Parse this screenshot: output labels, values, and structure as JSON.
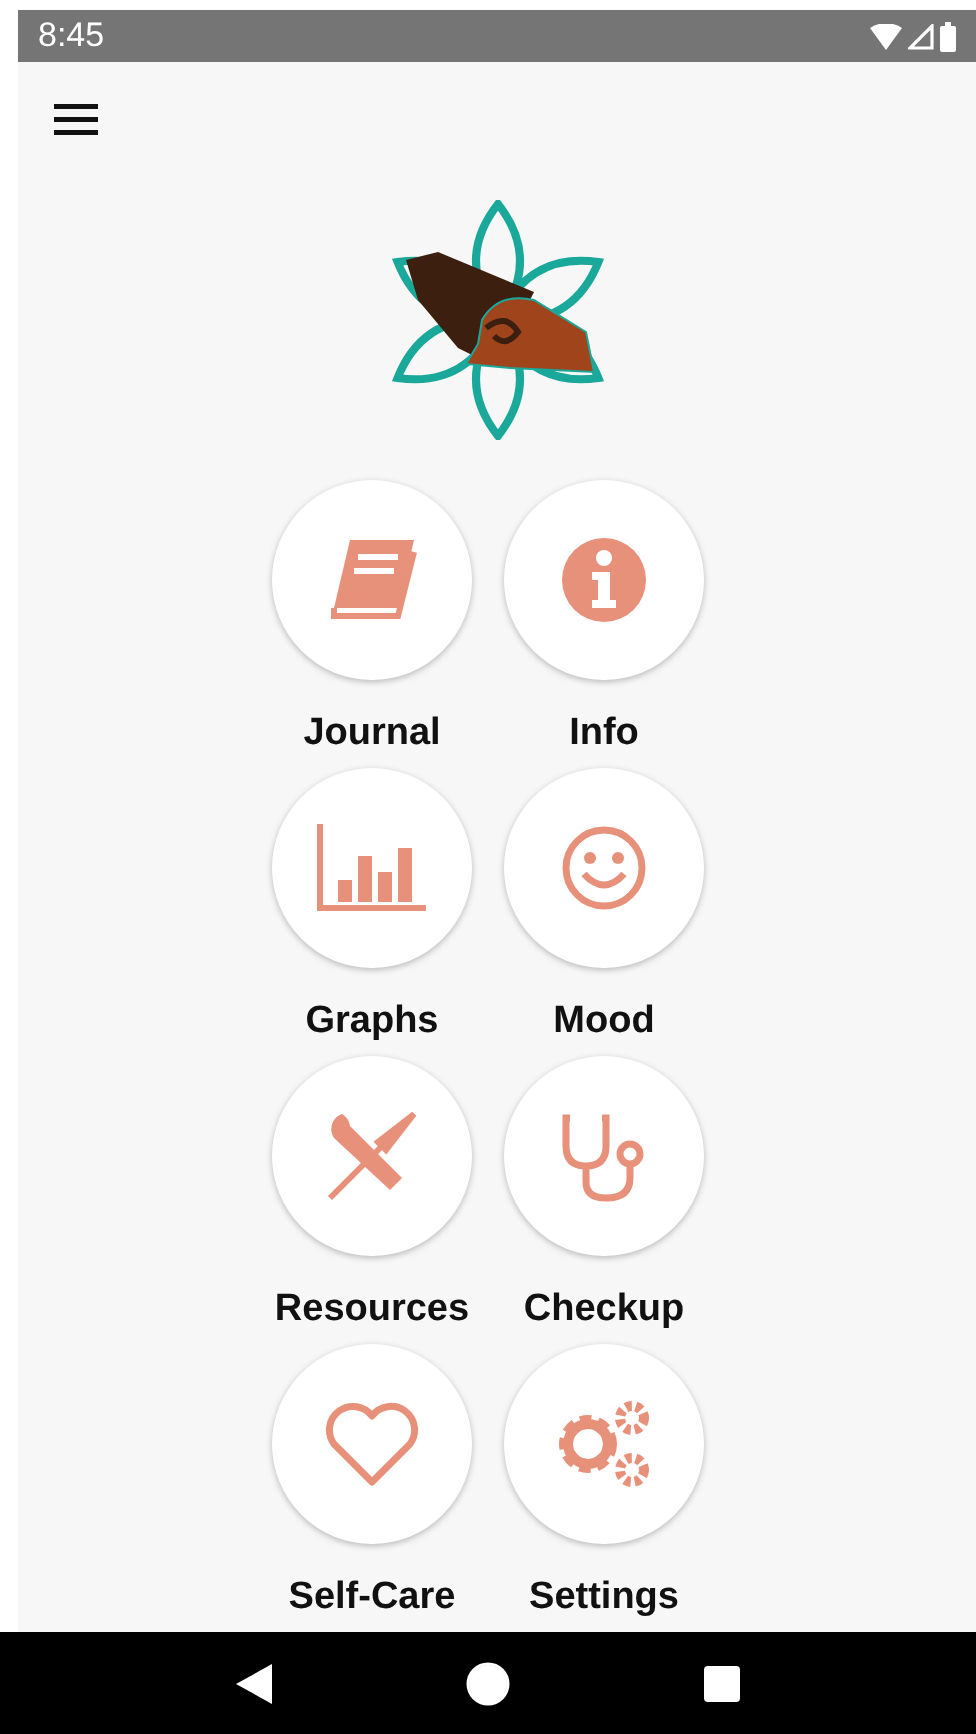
{
  "status_bar": {
    "time": "8:45"
  },
  "tiles": [
    {
      "label": "Journal"
    },
    {
      "label": "Info"
    },
    {
      "label": "Graphs"
    },
    {
      "label": "Mood"
    },
    {
      "label": "Resources"
    },
    {
      "label": "Checkup"
    },
    {
      "label": "Self-Care"
    },
    {
      "label": "Settings"
    }
  ]
}
